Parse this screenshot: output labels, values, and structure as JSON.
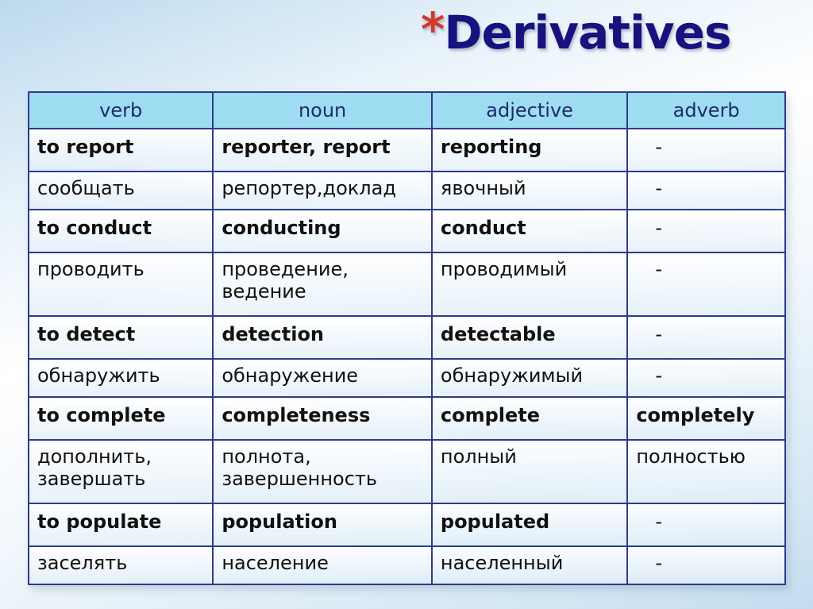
{
  "title": {
    "star": "*",
    "text": "Derivatives"
  },
  "table": {
    "headers": [
      "verb",
      "noun",
      "adjective",
      "adverb"
    ],
    "rows": [
      {
        "lang": "en",
        "cells": [
          "to report",
          "reporter, report",
          "reporting",
          "-"
        ]
      },
      {
        "lang": "ru",
        "cells": [
          "сообщать",
          "репортер,доклад",
          "явочный",
          "-"
        ]
      },
      {
        "lang": "en",
        "cells": [
          "to conduct",
          "conducting",
          "conduct",
          "-"
        ]
      },
      {
        "lang": "ru",
        "cells": [
          "проводить",
          "проведение, ведение",
          "проводимый",
          "-"
        ]
      },
      {
        "lang": "en",
        "cells": [
          "to detect",
          "detection",
          "detectable",
          "-"
        ]
      },
      {
        "lang": "ru",
        "cells": [
          "обнаружить",
          "обнаружение",
          "обнаружимый",
          "-"
        ]
      },
      {
        "lang": "en",
        "cells": [
          "to complete",
          "completeness",
          "complete",
          "completely"
        ]
      },
      {
        "lang": "ru",
        "cells": [
          "дополнить, завершать",
          "полнота, завершенность",
          "полный",
          "полностью"
        ]
      },
      {
        "lang": "en",
        "cells": [
          "to populate",
          "population",
          "populated",
          "-"
        ]
      },
      {
        "lang": "ru",
        "cells": [
          "заселять",
          "население",
          "населенный",
          "-"
        ]
      }
    ]
  },
  "colors": {
    "title": "#17127d",
    "star": "#d33a2a",
    "header_bg": "#9edcf2",
    "border": "#2e3b8a"
  }
}
